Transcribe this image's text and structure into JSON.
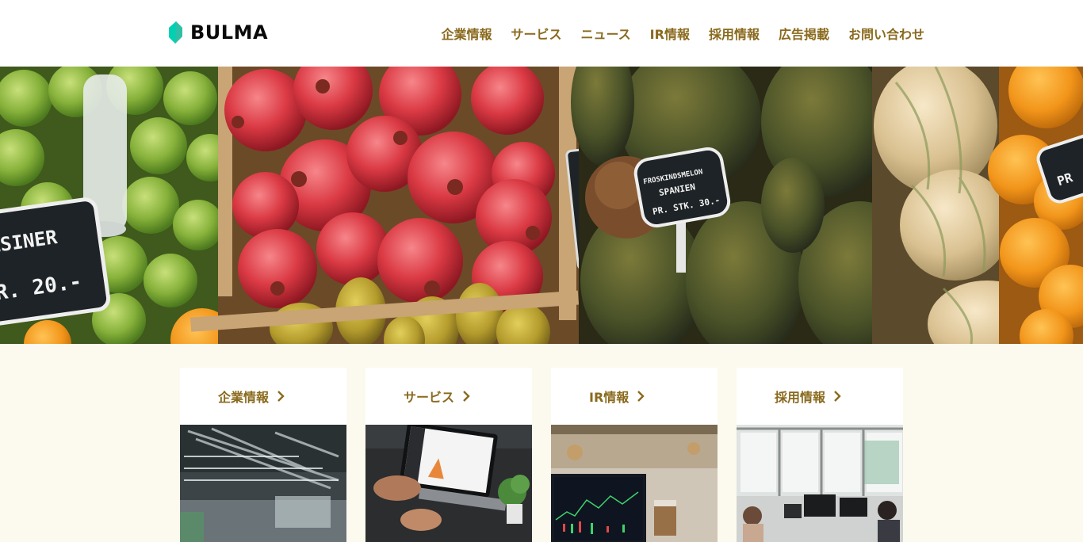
{
  "header": {
    "brand": "BULMA",
    "nav": [
      "企業情報",
      "サービス",
      "ニュース",
      "IR情報",
      "採用情報",
      "広告掲載",
      "お問い合わせ"
    ]
  },
  "hero": {
    "signs": [
      "LSINER",
      "R. 20.-",
      "FROSKINDSMELON",
      "SPANIEN",
      "PR. STK. 30.-",
      "PR"
    ]
  },
  "cards": [
    {
      "title": "企業情報",
      "image": "office-interior-image"
    },
    {
      "title": "サービス",
      "image": "laptop-meeting-image"
    },
    {
      "title": "IR情報",
      "image": "stock-chart-image"
    },
    {
      "title": "採用情報",
      "image": "workplace-image"
    }
  ],
  "colors": {
    "nav_text": "#8a6a1e",
    "brand_mark": "#00d1b2",
    "page_bg": "#fcf9ee"
  }
}
